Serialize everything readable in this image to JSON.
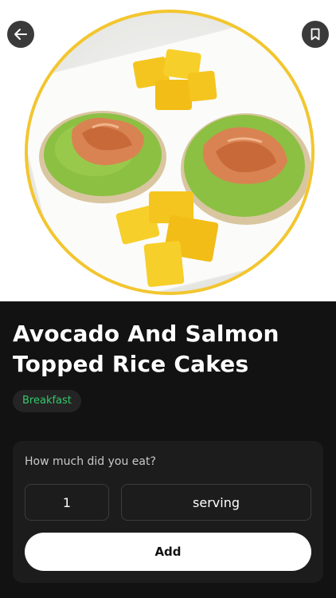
{
  "header": {
    "back_icon": "arrow-left-icon",
    "bookmark_icon": "bookmark-icon"
  },
  "recipe": {
    "title": "Avocado And Salmon Topped Rice Cakes",
    "category": "Breakfast"
  },
  "portion": {
    "question": "How much did you eat?",
    "quantity": "1",
    "unit": "serving",
    "add_label": "Add"
  },
  "colors": {
    "background": "#121212",
    "card": "#1c1c1c",
    "tag_text": "#35c86b",
    "plate_ring": "#f2c62e",
    "button": "#ffffff"
  }
}
